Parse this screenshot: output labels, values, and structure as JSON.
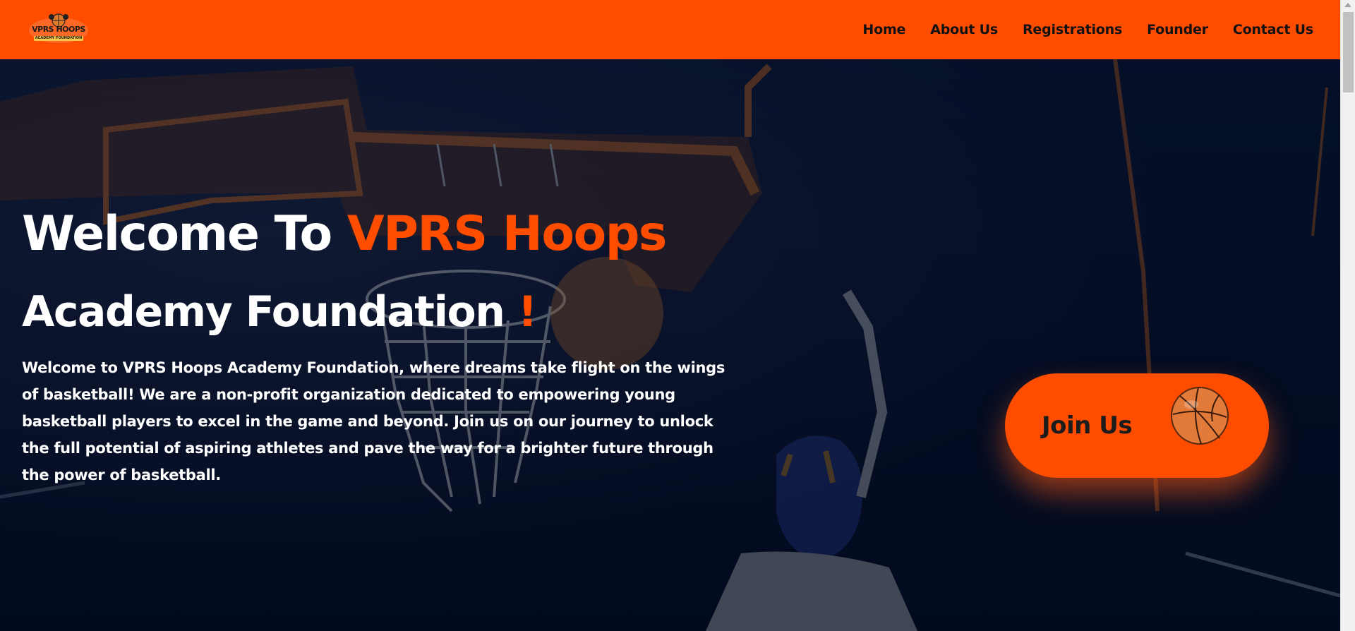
{
  "logo": {
    "text": "VPRS HOOPS",
    "subtext": "ACADEMY FOUNDATION"
  },
  "nav": {
    "items": [
      "Home",
      "About Us",
      "Registrations",
      "Founder",
      "Contact Us"
    ]
  },
  "hero": {
    "title_part1": "Welcome To ",
    "title_accent": "VPRS Hoops",
    "title_line2": "Academy Foundation ",
    "title_line2_accent": "!",
    "description": "Welcome to VPRS Hoops Academy Foundation, where dreams take flight on the wings of basketball! We are a non-profit organization dedicated to empowering young basketball players to excel in the game and beyond. Join us on our journey to unlock the full potential of aspiring athletes and pave the way for a brighter future through the power of basketball.",
    "cta_label": "Join Us"
  },
  "colors": {
    "brand_orange": "#ff4d00",
    "hero_background": "#030b1e",
    "text_white": "#ffffff"
  },
  "icons": {
    "cta_icon": "basketball-icon",
    "scroll_up": "scroll-up-arrow-icon"
  }
}
